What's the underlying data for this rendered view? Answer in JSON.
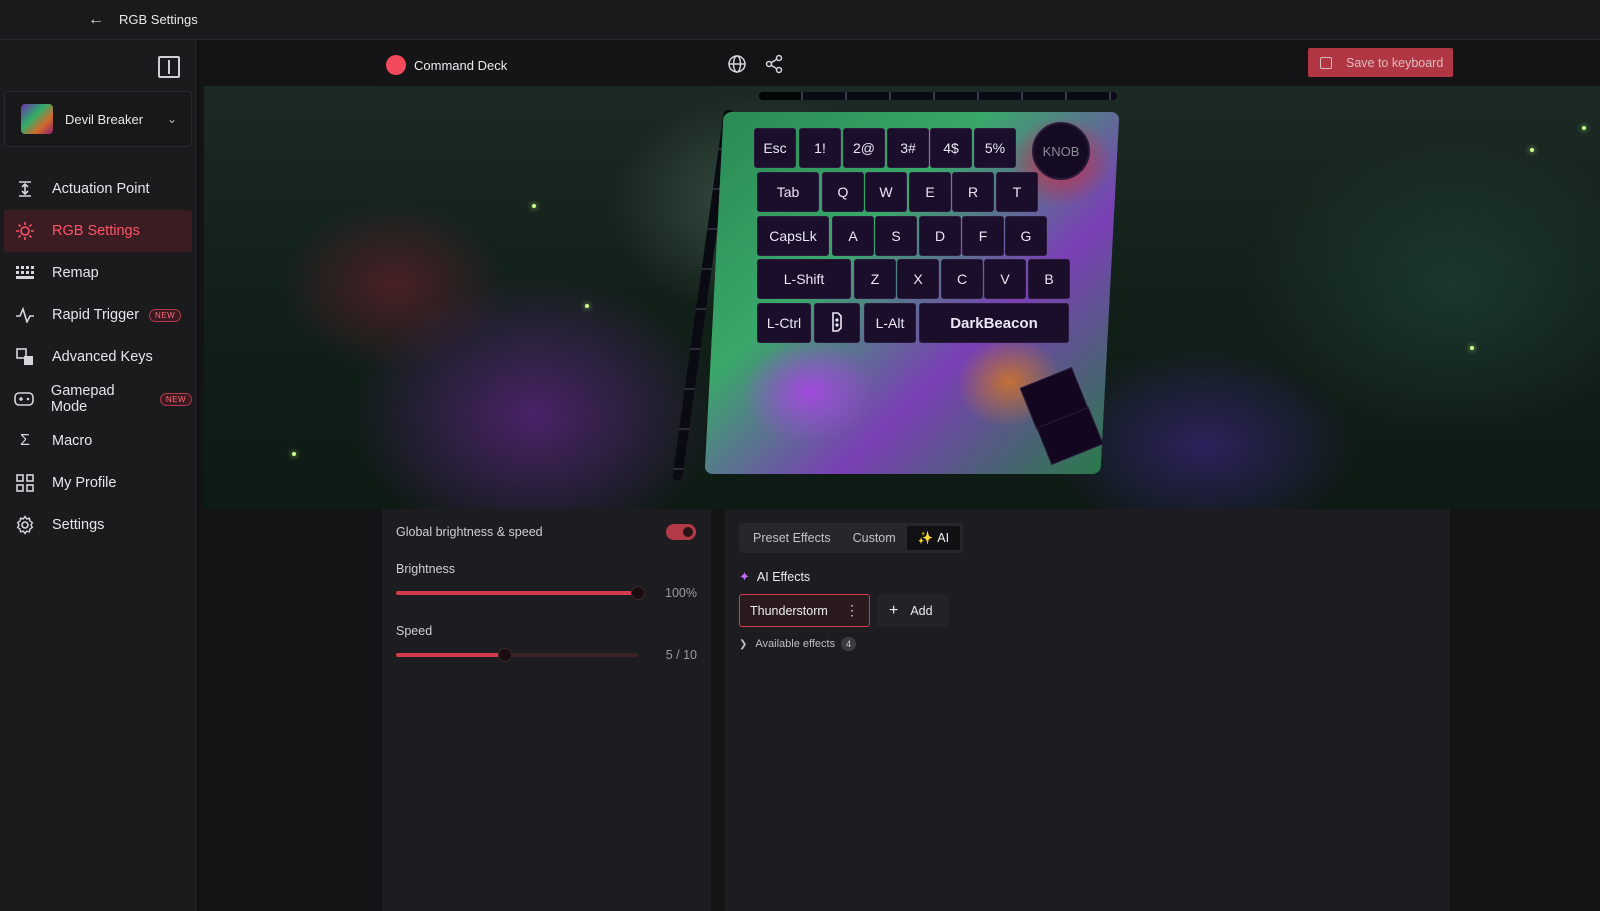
{
  "titlebar": {
    "title": "RGB Settings"
  },
  "device": {
    "name": "Devil Breaker"
  },
  "nav": {
    "items": [
      {
        "label": "Actuation Point",
        "icon": "actuation-icon",
        "badge": ""
      },
      {
        "label": "RGB Settings",
        "icon": "sun-icon",
        "badge": "",
        "active": true
      },
      {
        "label": "Remap",
        "icon": "keyboard-grid-icon",
        "badge": ""
      },
      {
        "label": "Rapid Trigger",
        "icon": "pulse-icon",
        "badge": "NEW"
      },
      {
        "label": "Advanced Keys",
        "icon": "layers-icon",
        "badge": ""
      },
      {
        "label": "Gamepad Mode",
        "icon": "gamepad-icon",
        "badge": "NEW"
      },
      {
        "label": "Macro",
        "icon": "sigma-icon",
        "badge": ""
      },
      {
        "label": "My Profile",
        "icon": "grid-icon",
        "badge": ""
      },
      {
        "label": "Settings",
        "icon": "gear-icon",
        "badge": ""
      }
    ]
  },
  "toolbar": {
    "profile_name": "Command Deck",
    "save_label": "Save to keyboard",
    "profile_color": "#f24a5a"
  },
  "keyboard": {
    "knob_label": "KNOB",
    "rows": [
      [
        "Esc",
        "1!",
        "2@",
        "3#",
        "4$",
        "5%"
      ],
      [
        "Tab",
        "Q",
        "W",
        "E",
        "R",
        "T"
      ],
      [
        "CapsLk",
        "A",
        "S",
        "D",
        "F",
        "G"
      ],
      [
        "L-Shift",
        "Z",
        "X",
        "C",
        "V",
        "B"
      ],
      [
        "L-Ctrl",
        "",
        "L-Alt",
        "DarkBeacon"
      ]
    ]
  },
  "global": {
    "heading": "Global brightness & speed",
    "enabled": true,
    "brightness": {
      "label": "Brightness",
      "value_text": "100%",
      "fraction": 1.0
    },
    "speed": {
      "label": "Speed",
      "value_text": "5 / 10",
      "fraction": 0.45
    }
  },
  "effects": {
    "tabs": [
      "Preset Effects",
      "Custom",
      "AI"
    ],
    "active_tab": "AI",
    "section_title": "AI Effects",
    "current_effect": "Thunderstorm",
    "add_label": "Add",
    "available_label": "Available effects",
    "available_count": "4"
  },
  "colors": {
    "accent": "#d23b4c",
    "active_nav": "#ff5468"
  }
}
